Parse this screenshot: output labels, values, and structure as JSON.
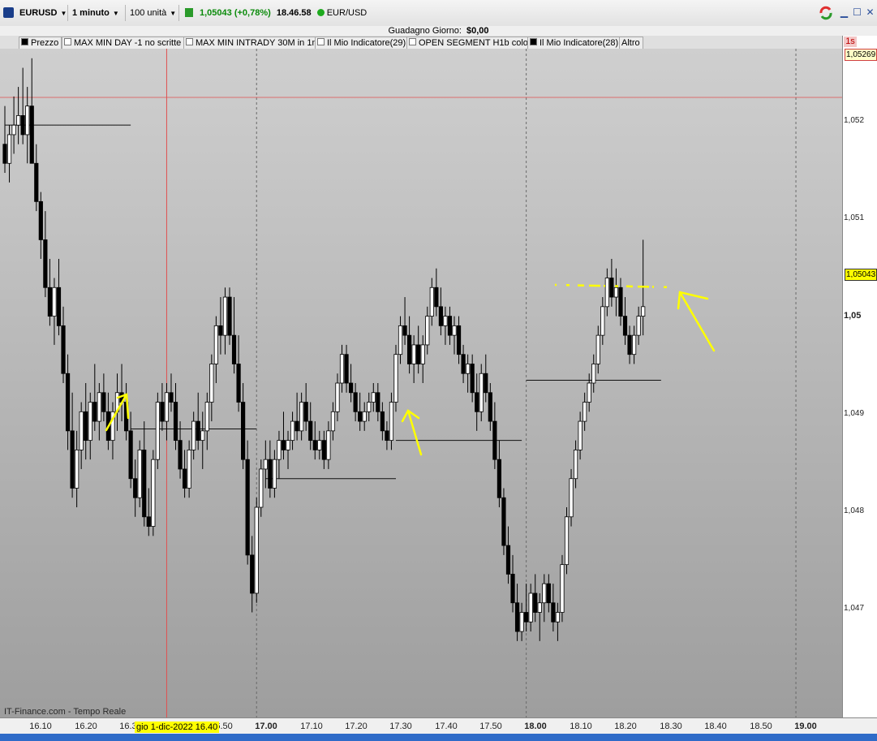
{
  "toolbar": {
    "symbol": "EURUSD",
    "timeframe": "1 minuto",
    "units": "100 unità",
    "price": "1,05043 (+0,78%)",
    "clock": "18.46.58",
    "instrument": "EUR/USD"
  },
  "gain": {
    "label": "Guadagno Giorno:",
    "value": "$0,00"
  },
  "indicators": [
    {
      "label": "Prezzo",
      "checked": true
    },
    {
      "label": "MAX MIN DAY -1 no scritte",
      "checked": false
    },
    {
      "label": "MAX MIN INTRADY 30M in 1m",
      "checked": false
    },
    {
      "label": "Il Mio Indicatore(29)",
      "checked": false
    },
    {
      "label": "OPEN SEGMENT  H1b color",
      "checked": false
    },
    {
      "label": "Il Mio Indicatore(28)",
      "checked": true
    },
    {
      "label": "Altro",
      "checked": false
    }
  ],
  "price_scale": {
    "timeframe_badge": "1s",
    "labels": [
      "1,052",
      "1,051",
      "1,05",
      "1,049",
      "1,048",
      "1,047"
    ],
    "red_tag": "1,05269",
    "current_tag": "1,05043"
  },
  "time_axis": {
    "labels": [
      "16.10",
      "16.20",
      "16.30",
      "16.50",
      "17.00",
      "17.10",
      "17.20",
      "17.30",
      "17.40",
      "17.50",
      "18.00",
      "18.10",
      "18.20",
      "18.30",
      "18.40",
      "18.50",
      "19.00"
    ],
    "cursor_date": "gio 1-dic-2022 16.40"
  },
  "footer": {
    "source": "IT-Finance.com - Tempo Reale"
  },
  "colors": {
    "accent_green": "#1eaa1e",
    "highlight": "#ffff00",
    "red_line": "#e05050"
  },
  "chart_data": {
    "type": "candlestick",
    "y_range": [
      1.0462,
      1.0532
    ],
    "x_range": [
      "16.04",
      "19.00"
    ],
    "candles": [
      [
        1.0522,
        1.0526,
        1.0519,
        1.052
      ],
      [
        1.052,
        1.0524,
        1.0518,
        1.0523
      ],
      [
        1.0523,
        1.0527,
        1.0521,
        1.0524
      ],
      [
        1.0524,
        1.0528,
        1.0522,
        1.0525
      ],
      [
        1.0525,
        1.053,
        1.0522,
        1.0523
      ],
      [
        1.0523,
        1.0528,
        1.052,
        1.0526
      ],
      [
        1.0526,
        1.0531,
        1.0521,
        1.052
      ],
      [
        1.052,
        1.0522,
        1.0515,
        1.0516
      ],
      [
        1.0516,
        1.0517,
        1.051,
        1.0512
      ],
      [
        1.0512,
        1.0515,
        1.0506,
        1.0507
      ],
      [
        1.0507,
        1.051,
        1.0503,
        1.0504
      ],
      [
        1.0504,
        1.0508,
        1.0501,
        1.0507
      ],
      [
        1.0507,
        1.051,
        1.0502,
        1.0503
      ],
      [
        1.0503,
        1.0505,
        1.0497,
        1.0498
      ],
      [
        1.0498,
        1.05,
        1.049,
        1.0492
      ],
      [
        1.0492,
        1.0496,
        1.0485,
        1.0486
      ],
      [
        1.0486,
        1.0492,
        1.0484,
        1.049
      ],
      [
        1.049,
        1.0495,
        1.0488,
        1.0494
      ],
      [
        1.0494,
        1.0497,
        1.0489,
        1.0491
      ],
      [
        1.0491,
        1.0496,
        1.0489,
        1.0495
      ],
      [
        1.0495,
        1.0499,
        1.0492,
        1.0493
      ],
      [
        1.0493,
        1.0497,
        1.0491,
        1.0496
      ],
      [
        1.0496,
        1.0498,
        1.0493,
        1.0494
      ],
      [
        1.0494,
        1.0496,
        1.049,
        1.0491
      ],
      [
        1.0491,
        1.0495,
        1.0489,
        1.0494
      ],
      [
        1.0494,
        1.0498,
        1.0492,
        1.0496
      ],
      [
        1.0496,
        1.0499,
        1.0493,
        1.0495
      ],
      [
        1.0495,
        1.0497,
        1.0491,
        1.0492
      ],
      [
        1.0492,
        1.0494,
        1.0486,
        1.0487
      ],
      [
        1.0487,
        1.0489,
        1.0483,
        1.0485
      ],
      [
        1.0485,
        1.0491,
        1.0484,
        1.049
      ],
      [
        1.049,
        1.0493,
        1.0482,
        1.0483
      ],
      [
        1.0483,
        1.0486,
        1.0481,
        1.0482
      ],
      [
        1.0482,
        1.049,
        1.0481,
        1.0489
      ],
      [
        1.0489,
        1.0496,
        1.0488,
        1.0495
      ],
      [
        1.0495,
        1.0497,
        1.0492,
        1.0493
      ],
      [
        1.0493,
        1.0497,
        1.0491,
        1.0496
      ],
      [
        1.0496,
        1.0498,
        1.0494,
        1.0495
      ],
      [
        1.0495,
        1.0497,
        1.049,
        1.0491
      ],
      [
        1.0491,
        1.0493,
        1.0487,
        1.0488
      ],
      [
        1.0488,
        1.049,
        1.0485,
        1.0486
      ],
      [
        1.0486,
        1.0491,
        1.0485,
        1.049
      ],
      [
        1.049,
        1.0494,
        1.0489,
        1.0493
      ],
      [
        1.0493,
        1.0496,
        1.049,
        1.0491
      ],
      [
        1.0491,
        1.0494,
        1.0488,
        1.0492
      ],
      [
        1.0492,
        1.0496,
        1.049,
        1.0495
      ],
      [
        1.0495,
        1.05,
        1.0493,
        1.0499
      ],
      [
        1.0499,
        1.0504,
        1.0497,
        1.0503
      ],
      [
        1.0503,
        1.0506,
        1.05,
        1.0502
      ],
      [
        1.0502,
        1.0507,
        1.05,
        1.0506
      ],
      [
        1.0506,
        1.0507,
        1.0501,
        1.0502
      ],
      [
        1.0502,
        1.0506,
        1.0498,
        1.0499
      ],
      [
        1.0499,
        1.0502,
        1.0494,
        1.0495
      ],
      [
        1.0495,
        1.0497,
        1.0488,
        1.0489
      ],
      [
        1.0489,
        1.0491,
        1.0478,
        1.0479
      ],
      [
        1.0479,
        1.0481,
        1.0473,
        1.0475
      ],
      [
        1.0475,
        1.0485,
        1.0474,
        1.0484
      ],
      [
        1.0484,
        1.0489,
        1.0483,
        1.0488
      ],
      [
        1.0488,
        1.0491,
        1.0486,
        1.0489
      ],
      [
        1.0489,
        1.0491,
        1.0485,
        1.0486
      ],
      [
        1.0486,
        1.049,
        1.0485,
        1.0489
      ],
      [
        1.0489,
        1.0492,
        1.0487,
        1.0491
      ],
      [
        1.0491,
        1.0494,
        1.0489,
        1.049
      ],
      [
        1.049,
        1.0492,
        1.0488,
        1.0491
      ],
      [
        1.0491,
        1.0494,
        1.049,
        1.0493
      ],
      [
        1.0493,
        1.0496,
        1.0491,
        1.0492
      ],
      [
        1.0492,
        1.0496,
        1.0491,
        1.0495
      ],
      [
        1.0495,
        1.0497,
        1.0492,
        1.0493
      ],
      [
        1.0493,
        1.0495,
        1.049,
        1.0491
      ],
      [
        1.0491,
        1.0493,
        1.0489,
        1.049
      ],
      [
        1.049,
        1.0492,
        1.0489,
        1.0491
      ],
      [
        1.0491,
        1.0492,
        1.0488,
        1.0489
      ],
      [
        1.0489,
        1.0493,
        1.0488,
        1.0492
      ],
      [
        1.0492,
        1.0495,
        1.0491,
        1.0494
      ],
      [
        1.0494,
        1.0498,
        1.0493,
        1.0497
      ],
      [
        1.0497,
        1.0501,
        1.0496,
        1.05
      ],
      [
        1.05,
        1.0501,
        1.0496,
        1.0497
      ],
      [
        1.0497,
        1.0499,
        1.0495,
        1.0496
      ],
      [
        1.0496,
        1.0497,
        1.0493,
        1.0494
      ],
      [
        1.0494,
        1.0496,
        1.0492,
        1.0493
      ],
      [
        1.0493,
        1.0495,
        1.0492,
        1.0494
      ],
      [
        1.0494,
        1.0496,
        1.0493,
        1.0495
      ],
      [
        1.0495,
        1.0497,
        1.0494,
        1.0496
      ],
      [
        1.0496,
        1.0497,
        1.0493,
        1.0494
      ],
      [
        1.0494,
        1.0495,
        1.0491,
        1.0492
      ],
      [
        1.0492,
        1.0493,
        1.049,
        1.0491
      ],
      [
        1.0491,
        1.0496,
        1.049,
        1.0495
      ],
      [
        1.0495,
        1.0501,
        1.0494,
        1.05
      ],
      [
        1.05,
        1.0504,
        1.0499,
        1.0503
      ],
      [
        1.0503,
        1.0506,
        1.0501,
        1.0502
      ],
      [
        1.0502,
        1.0504,
        1.0498,
        1.0499
      ],
      [
        1.0499,
        1.0502,
        1.0497,
        1.0501
      ],
      [
        1.0501,
        1.0503,
        1.0498,
        1.0499
      ],
      [
        1.0499,
        1.0502,
        1.0497,
        1.0501
      ],
      [
        1.0501,
        1.0505,
        1.05,
        1.0504
      ],
      [
        1.0504,
        1.0508,
        1.0503,
        1.0507
      ],
      [
        1.0507,
        1.0509,
        1.0504,
        1.0505
      ],
      [
        1.0505,
        1.0507,
        1.0502,
        1.0503
      ],
      [
        1.0503,
        1.0505,
        1.0501,
        1.0504
      ],
      [
        1.0504,
        1.0505,
        1.0501,
        1.0502
      ],
      [
        1.0502,
        1.0504,
        1.05,
        1.0503
      ],
      [
        1.0503,
        1.0504,
        1.0499,
        1.05
      ],
      [
        1.05,
        1.0501,
        1.0497,
        1.0498
      ],
      [
        1.0498,
        1.05,
        1.0496,
        1.0499
      ],
      [
        1.0499,
        1.05,
        1.0495,
        1.0496
      ],
      [
        1.0496,
        1.0498,
        1.0492,
        1.0494
      ],
      [
        1.0494,
        1.0499,
        1.0493,
        1.0498
      ],
      [
        1.0498,
        1.05,
        1.0495,
        1.0496
      ],
      [
        1.0496,
        1.0497,
        1.0492,
        1.0493
      ],
      [
        1.0493,
        1.0495,
        1.0488,
        1.0489
      ],
      [
        1.0489,
        1.0491,
        1.0484,
        1.0485
      ],
      [
        1.0485,
        1.0486,
        1.0479,
        1.048
      ],
      [
        1.048,
        1.0482,
        1.0476,
        1.0477
      ],
      [
        1.0477,
        1.0479,
        1.0473,
        1.0474
      ],
      [
        1.0474,
        1.0476,
        1.047,
        1.0471
      ],
      [
        1.0471,
        1.0474,
        1.047,
        1.0473
      ],
      [
        1.0473,
        1.0476,
        1.0471,
        1.0472
      ],
      [
        1.0472,
        1.0476,
        1.0471,
        1.0475
      ],
      [
        1.0475,
        1.0477,
        1.0472,
        1.0473
      ],
      [
        1.0473,
        1.0475,
        1.047,
        1.0474
      ],
      [
        1.0474,
        1.0477,
        1.0472,
        1.0476
      ],
      [
        1.0476,
        1.0477,
        1.0473,
        1.0474
      ],
      [
        1.0474,
        1.0476,
        1.0471,
        1.0472
      ],
      [
        1.0472,
        1.0474,
        1.047,
        1.0473
      ],
      [
        1.0473,
        1.0479,
        1.0472,
        1.0478
      ],
      [
        1.0478,
        1.0484,
        1.0477,
        1.0483
      ],
      [
        1.0483,
        1.0488,
        1.0482,
        1.0487
      ],
      [
        1.0487,
        1.0491,
        1.0486,
        1.049
      ],
      [
        1.049,
        1.0494,
        1.0489,
        1.0493
      ],
      [
        1.0493,
        1.0496,
        1.0492,
        1.0495
      ],
      [
        1.0495,
        1.0498,
        1.0494,
        1.0497
      ],
      [
        1.0497,
        1.05,
        1.0496,
        1.0499
      ],
      [
        1.0499,
        1.0503,
        1.0498,
        1.0502
      ],
      [
        1.0502,
        1.0506,
        1.0501,
        1.0505
      ],
      [
        1.0505,
        1.0509,
        1.0504,
        1.0508
      ],
      [
        1.0508,
        1.051,
        1.0505,
        1.0506
      ],
      [
        1.0506,
        1.0509,
        1.0504,
        1.0507
      ],
      [
        1.0507,
        1.0508,
        1.0503,
        1.0504
      ],
      [
        1.0504,
        1.0506,
        1.0501,
        1.0502
      ],
      [
        1.0502,
        1.0503,
        1.0499,
        1.05
      ],
      [
        1.05,
        1.0503,
        1.0499,
        1.0502
      ],
      [
        1.0502,
        1.0505,
        1.0501,
        1.0504
      ],
      [
        1.0504,
        1.0512,
        1.0502,
        1.0505
      ]
    ],
    "horizontal_levels": [
      {
        "y": 1.0524,
        "x_from": "16.04",
        "x_to": "16.32"
      },
      {
        "y": 1.04922,
        "x_from": "16.32",
        "x_to": "17.00"
      },
      {
        "y": 1.0487,
        "x_from": "17.02",
        "x_to": "17.31"
      },
      {
        "y": 1.0491,
        "x_from": "17.31",
        "x_to": "17.59"
      },
      {
        "y": 1.04973,
        "x_from": "18.00",
        "x_to": "18.30"
      }
    ],
    "vertical_marker": "16.40",
    "session_dividers": [
      "17.00",
      "18.00",
      "19.00"
    ],
    "annotations": [
      "arrow-16.31",
      "arrow-17.31",
      "arrow-18.32",
      "dashed-level-18.30"
    ]
  }
}
